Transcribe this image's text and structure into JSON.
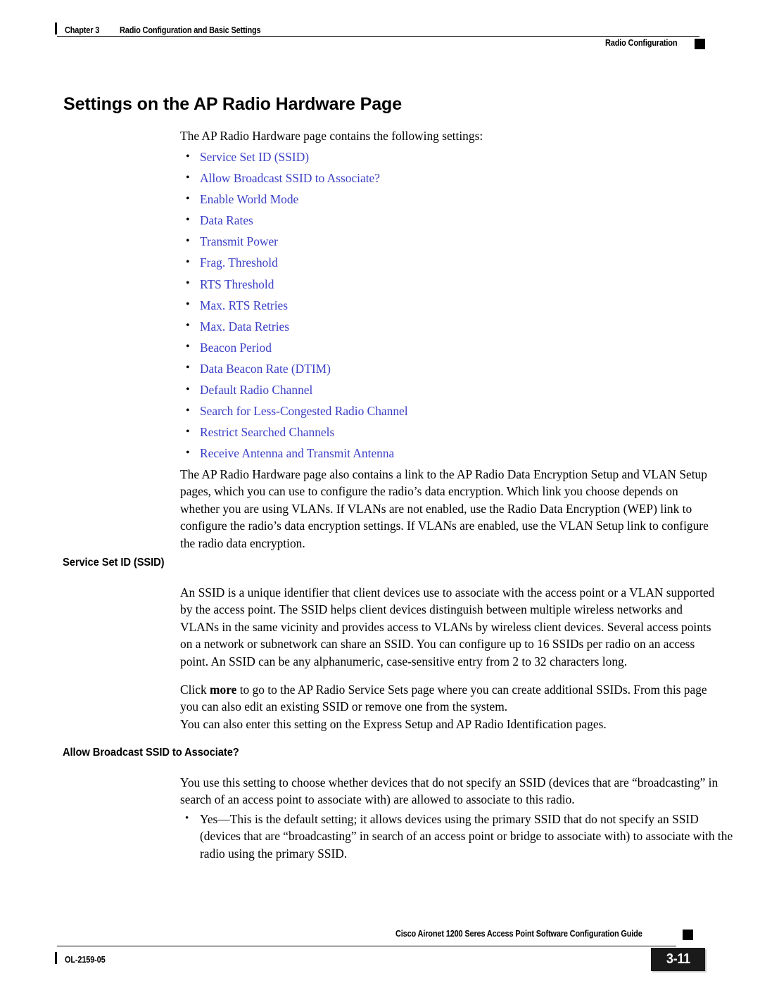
{
  "header": {
    "chapter_label": "Chapter 3",
    "chapter_title": "Radio Configuration and Basic Settings",
    "running_head_right": "Radio Configuration"
  },
  "content": {
    "page_title": "Settings on the AP Radio Hardware Page",
    "intro_paragraph": "The AP Radio Hardware page contains the following settings:",
    "settings_links": [
      "Service Set ID (SSID)",
      "Allow Broadcast SSID to Associate?",
      "Enable World Mode",
      "Data Rates",
      "Transmit Power",
      "Frag. Threshold",
      "RTS Threshold",
      "Max. RTS Retries",
      "Max. Data Retries",
      "Beacon Period",
      "Data Beacon Rate (DTIM)",
      "Default Radio Channel",
      "Search for Less-Congested Radio Channel",
      "Restrict Searched Channels",
      "Receive Antenna and Transmit Antenna"
    ],
    "encryption_paragraph": "The AP Radio Hardware page also contains a link to the AP Radio Data Encryption Setup and VLAN Setup pages, which you can use to configure the radio’s data encryption. Which link you choose depends on whether you are using VLANs. If VLANs are not enabled, use the Radio Data Encryption (WEP) link to configure the radio’s data encryption settings. If VLANs are enabled, use the VLAN Setup link to configure the radio data encryption.",
    "section_ssid": {
      "heading": "Service Set ID (SSID)",
      "paragraph_1": "An SSID is a unique identifier that client devices use to associate with the access point or a VLAN supported by the access point. The SSID helps client devices distinguish between multiple wireless networks and VLANs in the same vicinity and provides access to VLANs by wireless client devices. Several access points on a network or subnetwork can share an SSID. You can configure up to 16 SSIDs per radio on an access point. An SSID can be any alphanumeric, case-sensitive entry from 2 to 32 characters long.",
      "paragraph_2_pre": "Click ",
      "paragraph_2_bold": "more",
      "paragraph_2_post": " to go to the AP Radio Service Sets page where you can create additional SSIDs. From this page you can also edit an existing SSID or remove one from the system.",
      "paragraph_3": "You can also enter this setting on the Express Setup and AP Radio Identification pages."
    },
    "section_broadcast": {
      "heading": "Allow Broadcast SSID to Associate?",
      "paragraph_1": "You use this setting to choose whether devices that do not specify an SSID (devices that are “broadcasting” in search of an access point to associate with) are allowed to associate to this radio.",
      "bullet_1": "Yes—This is the default setting; it allows devices using the primary SSID that do not specify an SSID (devices that are “broadcasting” in search of an access point or bridge to associate with) to associate with the radio using the primary SSID."
    }
  },
  "footer": {
    "guide_title": "Cisco Aironet 1200 Seres Access Point Software Configuration Guide",
    "doc_number": "OL-2159-05",
    "page_number": "3-11"
  },
  "colors": {
    "link_blue": "#3a3fc6",
    "text_black": "#000000",
    "page_box": "#1a1a1a"
  }
}
